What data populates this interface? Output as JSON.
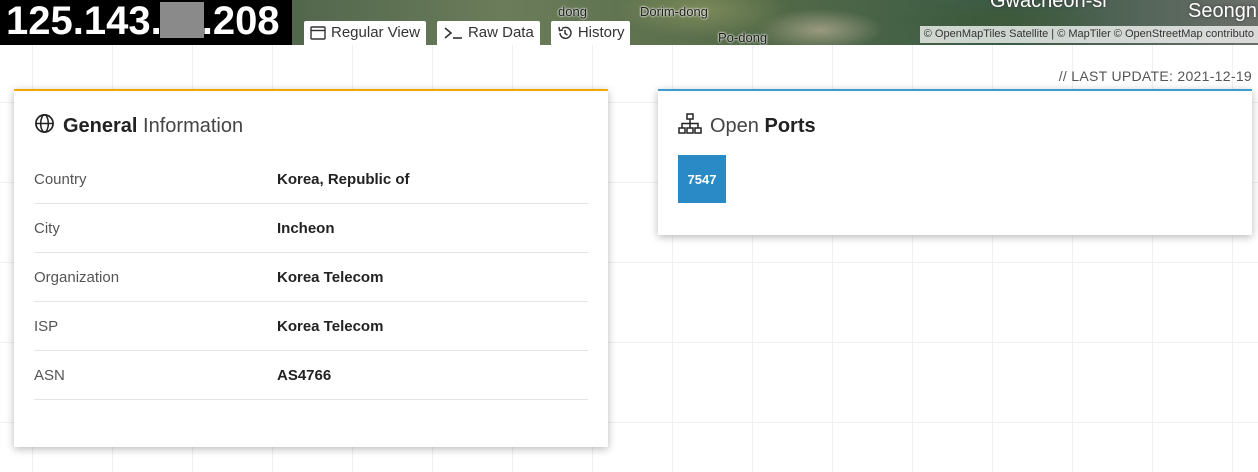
{
  "header": {
    "ip_prefix": "125.143.",
    "ip_suffix": ".208"
  },
  "map": {
    "labels": [
      "dong",
      "Dorim-dong",
      "Po-dong",
      "Gwacheon-si",
      "Seongn"
    ],
    "attribution": "© OpenMapTiles Satellite | © MapTiler © OpenStreetMap contributo"
  },
  "tabs": [
    {
      "label": "Regular View",
      "icon": "window-icon"
    },
    {
      "label": "Raw Data",
      "icon": "terminal-icon"
    },
    {
      "label": "History",
      "icon": "history-icon"
    }
  ],
  "last_update": "// LAST UPDATE: 2021-12-19",
  "general": {
    "title_strong": "General",
    "title_light": "Information",
    "rows": [
      {
        "key": "Country",
        "value": "Korea, Republic of"
      },
      {
        "key": "City",
        "value": "Incheon"
      },
      {
        "key": "Organization",
        "value": "Korea Telecom"
      },
      {
        "key": "ISP",
        "value": "Korea Telecom"
      },
      {
        "key": "ASN",
        "value": "AS4766"
      }
    ]
  },
  "ports": {
    "title_light": "Open",
    "title_strong": "Ports",
    "items": [
      "7547"
    ]
  },
  "colors": {
    "general_accent": "#f0a800",
    "ports_accent": "#3a9ccf",
    "port_badge": "#2a8ac6"
  }
}
